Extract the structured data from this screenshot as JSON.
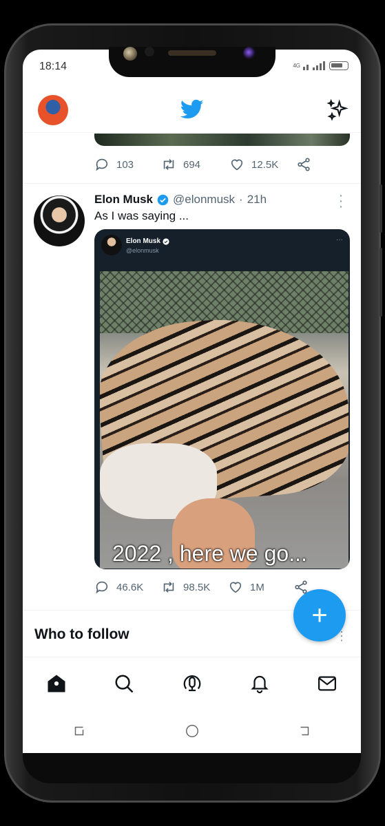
{
  "status_bar": {
    "time": "18:14",
    "network": "4G"
  },
  "header": {
    "logo": "twitter-bird-icon",
    "sparkle": "sparkle-icon"
  },
  "previous_tweet": {
    "replies": "103",
    "retweets": "694",
    "likes": "12.5K"
  },
  "tweet": {
    "author_name": "Elon Musk",
    "handle": "@elonmusk",
    "dot": "·",
    "time": "21h",
    "text": "As I was saying ...",
    "embedded": {
      "author_name": "Elon Musk",
      "handle": "@elonmusk",
      "more": "···",
      "caption": "2022 , here we go..."
    },
    "replies": "46.6K",
    "retweets": "98.5K",
    "likes": "1M"
  },
  "fab": {
    "label": "+"
  },
  "who_to_follow": {
    "title": "Who to follow"
  },
  "bottom_nav": [
    "home-icon",
    "search-icon",
    "spaces-icon",
    "notifications-icon",
    "messages-icon"
  ],
  "colors": {
    "accent": "#1d9bf0",
    "text": "#0f1419",
    "muted": "#536471"
  }
}
